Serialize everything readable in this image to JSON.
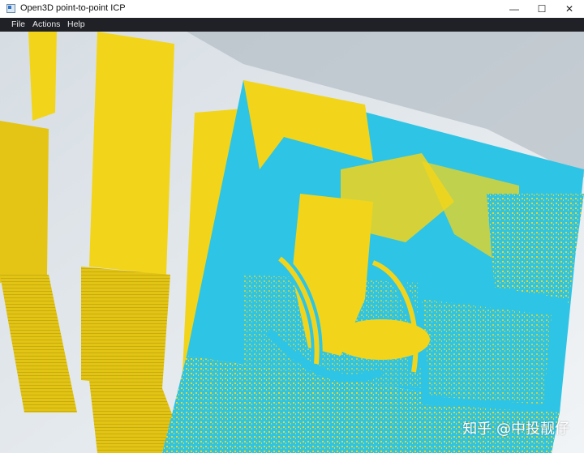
{
  "window": {
    "title": "Open3D point-to-point ICP",
    "controls": {
      "minimize": "—",
      "maximize": "☐",
      "close": "✕"
    }
  },
  "menu": {
    "items": [
      "File",
      "Actions",
      "Help"
    ]
  },
  "viewport": {
    "description_colors": {
      "source_cloud": "#f2d51a",
      "target_cloud": "#2ec4e6",
      "background": "#e5ebef"
    }
  },
  "watermark": "知乎 @中投靓仔",
  "colors": {
    "titlebar": "#ffffff",
    "menubar": "#1f2126",
    "menu_text": "#eaeaea"
  }
}
